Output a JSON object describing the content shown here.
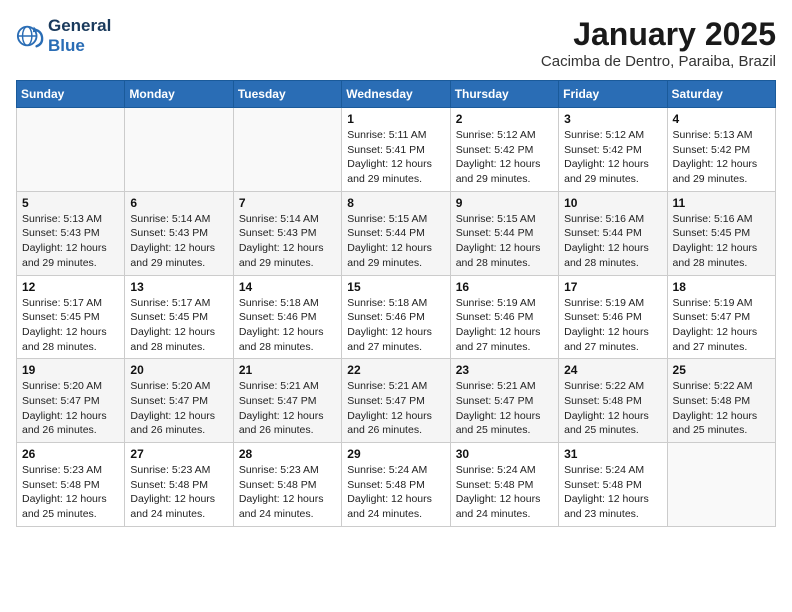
{
  "header": {
    "logo_line1": "General",
    "logo_line2": "Blue",
    "month_title": "January 2025",
    "location": "Cacimba de Dentro, Paraiba, Brazil"
  },
  "weekdays": [
    "Sunday",
    "Monday",
    "Tuesday",
    "Wednesday",
    "Thursday",
    "Friday",
    "Saturday"
  ],
  "weeks": [
    [
      {
        "day": "",
        "sunrise": "",
        "sunset": "",
        "daylight": ""
      },
      {
        "day": "",
        "sunrise": "",
        "sunset": "",
        "daylight": ""
      },
      {
        "day": "",
        "sunrise": "",
        "sunset": "",
        "daylight": ""
      },
      {
        "day": "1",
        "sunrise": "Sunrise: 5:11 AM",
        "sunset": "Sunset: 5:41 PM",
        "daylight": "Daylight: 12 hours and 29 minutes."
      },
      {
        "day": "2",
        "sunrise": "Sunrise: 5:12 AM",
        "sunset": "Sunset: 5:42 PM",
        "daylight": "Daylight: 12 hours and 29 minutes."
      },
      {
        "day": "3",
        "sunrise": "Sunrise: 5:12 AM",
        "sunset": "Sunset: 5:42 PM",
        "daylight": "Daylight: 12 hours and 29 minutes."
      },
      {
        "day": "4",
        "sunrise": "Sunrise: 5:13 AM",
        "sunset": "Sunset: 5:42 PM",
        "daylight": "Daylight: 12 hours and 29 minutes."
      }
    ],
    [
      {
        "day": "5",
        "sunrise": "Sunrise: 5:13 AM",
        "sunset": "Sunset: 5:43 PM",
        "daylight": "Daylight: 12 hours and 29 minutes."
      },
      {
        "day": "6",
        "sunrise": "Sunrise: 5:14 AM",
        "sunset": "Sunset: 5:43 PM",
        "daylight": "Daylight: 12 hours and 29 minutes."
      },
      {
        "day": "7",
        "sunrise": "Sunrise: 5:14 AM",
        "sunset": "Sunset: 5:43 PM",
        "daylight": "Daylight: 12 hours and 29 minutes."
      },
      {
        "day": "8",
        "sunrise": "Sunrise: 5:15 AM",
        "sunset": "Sunset: 5:44 PM",
        "daylight": "Daylight: 12 hours and 29 minutes."
      },
      {
        "day": "9",
        "sunrise": "Sunrise: 5:15 AM",
        "sunset": "Sunset: 5:44 PM",
        "daylight": "Daylight: 12 hours and 28 minutes."
      },
      {
        "day": "10",
        "sunrise": "Sunrise: 5:16 AM",
        "sunset": "Sunset: 5:44 PM",
        "daylight": "Daylight: 12 hours and 28 minutes."
      },
      {
        "day": "11",
        "sunrise": "Sunrise: 5:16 AM",
        "sunset": "Sunset: 5:45 PM",
        "daylight": "Daylight: 12 hours and 28 minutes."
      }
    ],
    [
      {
        "day": "12",
        "sunrise": "Sunrise: 5:17 AM",
        "sunset": "Sunset: 5:45 PM",
        "daylight": "Daylight: 12 hours and 28 minutes."
      },
      {
        "day": "13",
        "sunrise": "Sunrise: 5:17 AM",
        "sunset": "Sunset: 5:45 PM",
        "daylight": "Daylight: 12 hours and 28 minutes."
      },
      {
        "day": "14",
        "sunrise": "Sunrise: 5:18 AM",
        "sunset": "Sunset: 5:46 PM",
        "daylight": "Daylight: 12 hours and 28 minutes."
      },
      {
        "day": "15",
        "sunrise": "Sunrise: 5:18 AM",
        "sunset": "Sunset: 5:46 PM",
        "daylight": "Daylight: 12 hours and 27 minutes."
      },
      {
        "day": "16",
        "sunrise": "Sunrise: 5:19 AM",
        "sunset": "Sunset: 5:46 PM",
        "daylight": "Daylight: 12 hours and 27 minutes."
      },
      {
        "day": "17",
        "sunrise": "Sunrise: 5:19 AM",
        "sunset": "Sunset: 5:46 PM",
        "daylight": "Daylight: 12 hours and 27 minutes."
      },
      {
        "day": "18",
        "sunrise": "Sunrise: 5:19 AM",
        "sunset": "Sunset: 5:47 PM",
        "daylight": "Daylight: 12 hours and 27 minutes."
      }
    ],
    [
      {
        "day": "19",
        "sunrise": "Sunrise: 5:20 AM",
        "sunset": "Sunset: 5:47 PM",
        "daylight": "Daylight: 12 hours and 26 minutes."
      },
      {
        "day": "20",
        "sunrise": "Sunrise: 5:20 AM",
        "sunset": "Sunset: 5:47 PM",
        "daylight": "Daylight: 12 hours and 26 minutes."
      },
      {
        "day": "21",
        "sunrise": "Sunrise: 5:21 AM",
        "sunset": "Sunset: 5:47 PM",
        "daylight": "Daylight: 12 hours and 26 minutes."
      },
      {
        "day": "22",
        "sunrise": "Sunrise: 5:21 AM",
        "sunset": "Sunset: 5:47 PM",
        "daylight": "Daylight: 12 hours and 26 minutes."
      },
      {
        "day": "23",
        "sunrise": "Sunrise: 5:21 AM",
        "sunset": "Sunset: 5:47 PM",
        "daylight": "Daylight: 12 hours and 25 minutes."
      },
      {
        "day": "24",
        "sunrise": "Sunrise: 5:22 AM",
        "sunset": "Sunset: 5:48 PM",
        "daylight": "Daylight: 12 hours and 25 minutes."
      },
      {
        "day": "25",
        "sunrise": "Sunrise: 5:22 AM",
        "sunset": "Sunset: 5:48 PM",
        "daylight": "Daylight: 12 hours and 25 minutes."
      }
    ],
    [
      {
        "day": "26",
        "sunrise": "Sunrise: 5:23 AM",
        "sunset": "Sunset: 5:48 PM",
        "daylight": "Daylight: 12 hours and 25 minutes."
      },
      {
        "day": "27",
        "sunrise": "Sunrise: 5:23 AM",
        "sunset": "Sunset: 5:48 PM",
        "daylight": "Daylight: 12 hours and 24 minutes."
      },
      {
        "day": "28",
        "sunrise": "Sunrise: 5:23 AM",
        "sunset": "Sunset: 5:48 PM",
        "daylight": "Daylight: 12 hours and 24 minutes."
      },
      {
        "day": "29",
        "sunrise": "Sunrise: 5:24 AM",
        "sunset": "Sunset: 5:48 PM",
        "daylight": "Daylight: 12 hours and 24 minutes."
      },
      {
        "day": "30",
        "sunrise": "Sunrise: 5:24 AM",
        "sunset": "Sunset: 5:48 PM",
        "daylight": "Daylight: 12 hours and 24 minutes."
      },
      {
        "day": "31",
        "sunrise": "Sunrise: 5:24 AM",
        "sunset": "Sunset: 5:48 PM",
        "daylight": "Daylight: 12 hours and 23 minutes."
      },
      {
        "day": "",
        "sunrise": "",
        "sunset": "",
        "daylight": ""
      }
    ]
  ]
}
